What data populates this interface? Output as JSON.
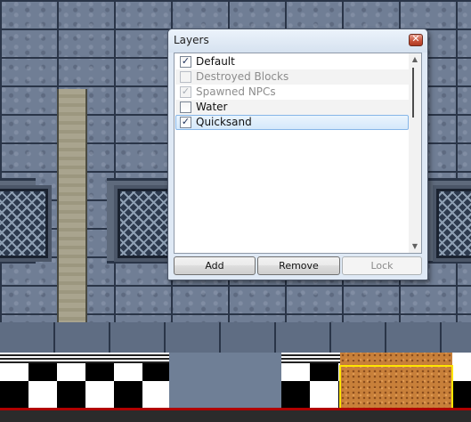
{
  "window": {
    "title": "Layers"
  },
  "layers": [
    {
      "label": "Default",
      "checked": true,
      "enabled": true,
      "selected": false
    },
    {
      "label": "Destroyed Blocks",
      "checked": false,
      "enabled": false,
      "selected": false
    },
    {
      "label": "Spawned NPCs",
      "checked": true,
      "enabled": false,
      "selected": false
    },
    {
      "label": "Water",
      "checked": false,
      "enabled": true,
      "selected": false
    },
    {
      "label": "Quicksand",
      "checked": true,
      "enabled": true,
      "selected": true
    }
  ],
  "buttons": {
    "add": "Add",
    "remove": "Remove",
    "lock": "Lock"
  },
  "icons": {
    "close": "close-icon",
    "check": "check-icon",
    "scroll_up": "scroll-up-arrow-icon",
    "scroll_down": "scroll-down-arrow-icon"
  },
  "colors": {
    "selection_highlight": "#d4e8fb",
    "selected_tile_outline": "#ffe500",
    "floor_line": "#b00000"
  }
}
